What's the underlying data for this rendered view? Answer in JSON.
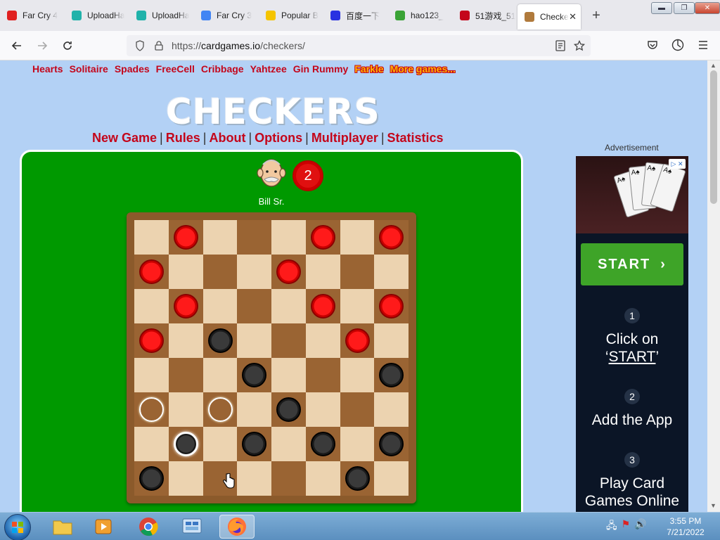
{
  "browser": {
    "tabs": [
      {
        "label": "Far Cry 4",
        "icon": "red-phone-icon",
        "color": "#e02020"
      },
      {
        "label": "UploadHa",
        "icon": "teal-upload-icon",
        "color": "#20b2aa"
      },
      {
        "label": "UploadHa",
        "icon": "teal-upload-icon",
        "color": "#20b2aa"
      },
      {
        "label": "Far Cry 3",
        "icon": "google-g-icon",
        "color": "#4285f4"
      },
      {
        "label": "Popular B",
        "icon": "smiley-icon",
        "color": "#f5c400"
      },
      {
        "label": "百度一下",
        "icon": "baidu-paw-icon",
        "color": "#2932e1"
      },
      {
        "label": "hao123_",
        "icon": "hao123-icon",
        "color": "#3aa336"
      },
      {
        "label": "51游戏_51",
        "icon": "51game-icon",
        "color": "#c4061b"
      },
      {
        "label": "Checke",
        "icon": "checkers-icon",
        "color": "#b07a3c",
        "active": true
      }
    ],
    "url_scheme": "https://",
    "url_host": "cardgames.io",
    "url_path": "/checkers/"
  },
  "site": {
    "game_links": [
      "Hearts",
      "Solitaire",
      "Spades",
      "FreeCell",
      "Cribbage",
      "Yahtzee",
      "Gin Rummy"
    ],
    "highlight_links": [
      "Farkle",
      "More games..."
    ],
    "logo": "CHECKERS",
    "menu": [
      "New Game",
      "Rules",
      "About",
      "Options",
      "Multiplayer",
      "Statistics"
    ]
  },
  "game": {
    "opponent_name": "Bill Sr.",
    "opponent_score": "2",
    "board": [
      [
        "",
        "R",
        "",
        "",
        "",
        "R",
        "",
        "R"
      ],
      [
        "R",
        "",
        "",
        "",
        "R",
        "",
        "",
        ""
      ],
      [
        "",
        "R",
        "",
        "",
        "",
        "R",
        "",
        "R"
      ],
      [
        "R",
        "",
        "B",
        "",
        "",
        "",
        "R",
        ""
      ],
      [
        "",
        "",
        "",
        "B",
        "",
        "",
        "",
        "B"
      ],
      [
        "T",
        "",
        "T",
        "",
        "B",
        "",
        "",
        ""
      ],
      [
        "",
        "S",
        "",
        "B",
        "",
        "B",
        "",
        "B"
      ],
      [
        "B",
        "",
        "",
        "",
        "",
        "",
        "B",
        ""
      ]
    ],
    "colors": {
      "red": "#e01010",
      "black": "#2a2a2a",
      "light_square": "#ecd3b0",
      "dark_square": "#9a6433",
      "felt": "#009900"
    }
  },
  "ad": {
    "label": "Advertisement",
    "start_button": "START",
    "steps": [
      {
        "num": "1",
        "pre": "Click on",
        "quote_open": "‘",
        "link": "START",
        "quote_close": "’"
      },
      {
        "num": "2",
        "text": "Add the App"
      },
      {
        "num": "3",
        "text": "Play Card Games Online"
      }
    ],
    "cards": [
      "A",
      "A",
      "A",
      "A"
    ]
  },
  "taskbar": {
    "time": "3:55 PM",
    "date": "7/21/2022"
  }
}
